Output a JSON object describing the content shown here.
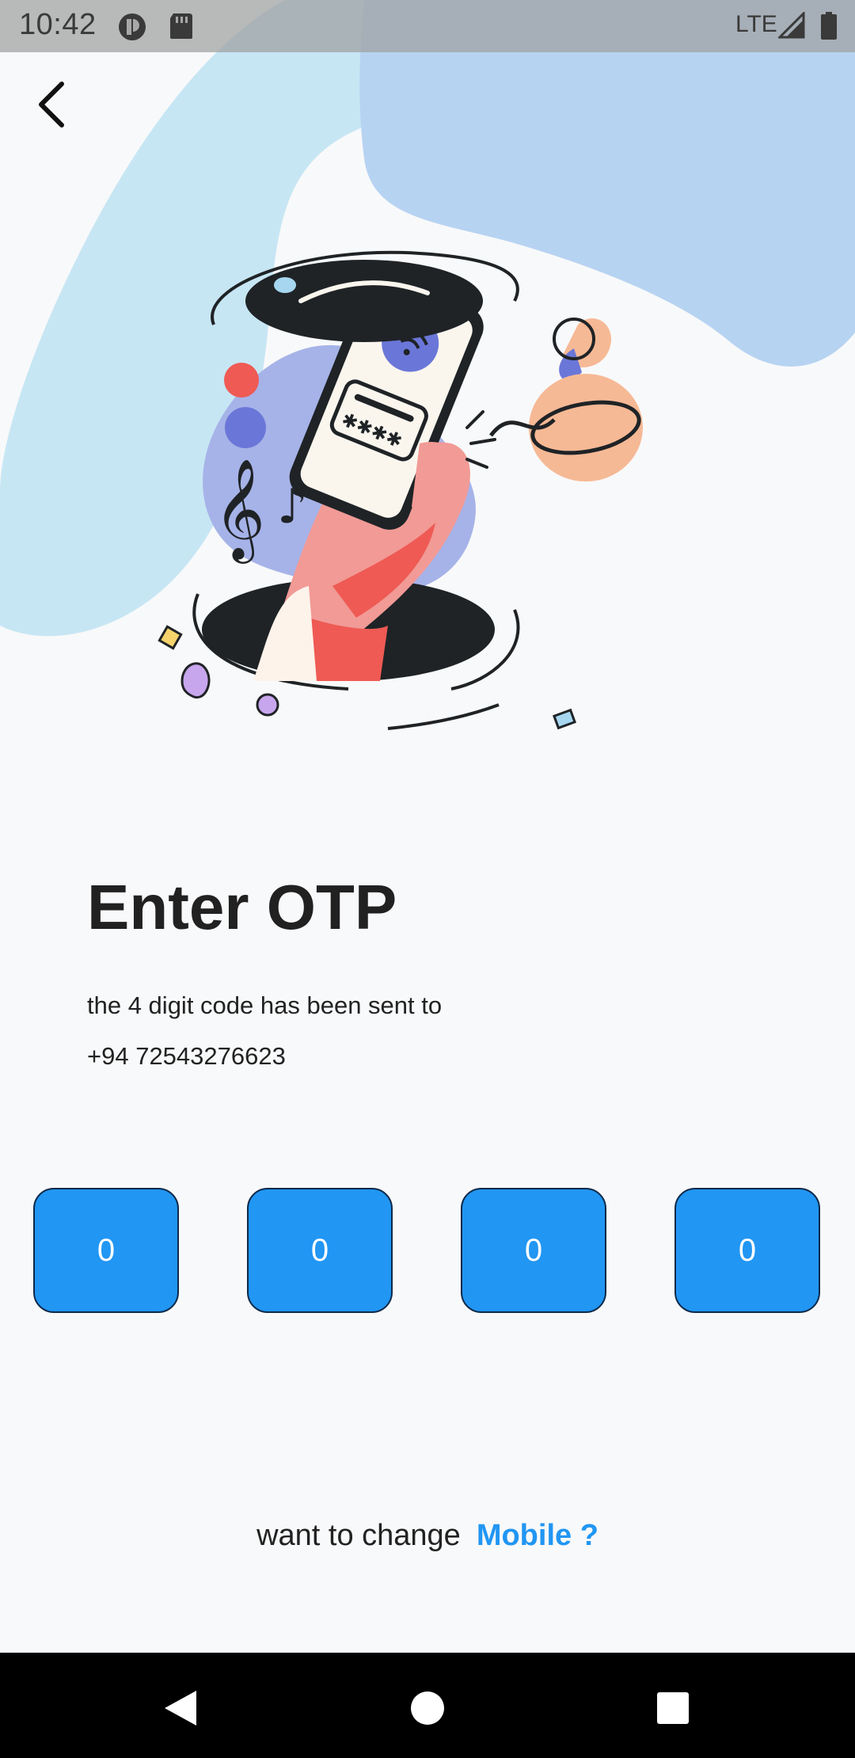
{
  "status_bar": {
    "time": "10:42",
    "network": "LTE",
    "icons": [
      "notification-app-icon",
      "sd-card-icon",
      "signal-icon",
      "battery-icon"
    ]
  },
  "header": {
    "back_icon": "chevron-left-icon"
  },
  "illustration": {
    "icon": "phone-otp-illustration"
  },
  "main": {
    "title": "Enter OTP",
    "description": "the 4 digit code has been sent to",
    "phone_number": "+94 72543276623",
    "otp_fields": [
      {
        "value": "0"
      },
      {
        "value": "0"
      },
      {
        "value": "0"
      },
      {
        "value": "0"
      }
    ],
    "change_prompt": "want to change",
    "change_link": "Mobile ?"
  },
  "nav_bar": {
    "icons": [
      "back-triangle-icon",
      "home-circle-icon",
      "recents-square-icon"
    ]
  },
  "colors": {
    "accent": "#2196f3",
    "otp_border": "#0d2a4a",
    "background": "#f8f9fa",
    "blob_light": "#c7e6f4",
    "blob_blue": "#b7d3f2"
  }
}
